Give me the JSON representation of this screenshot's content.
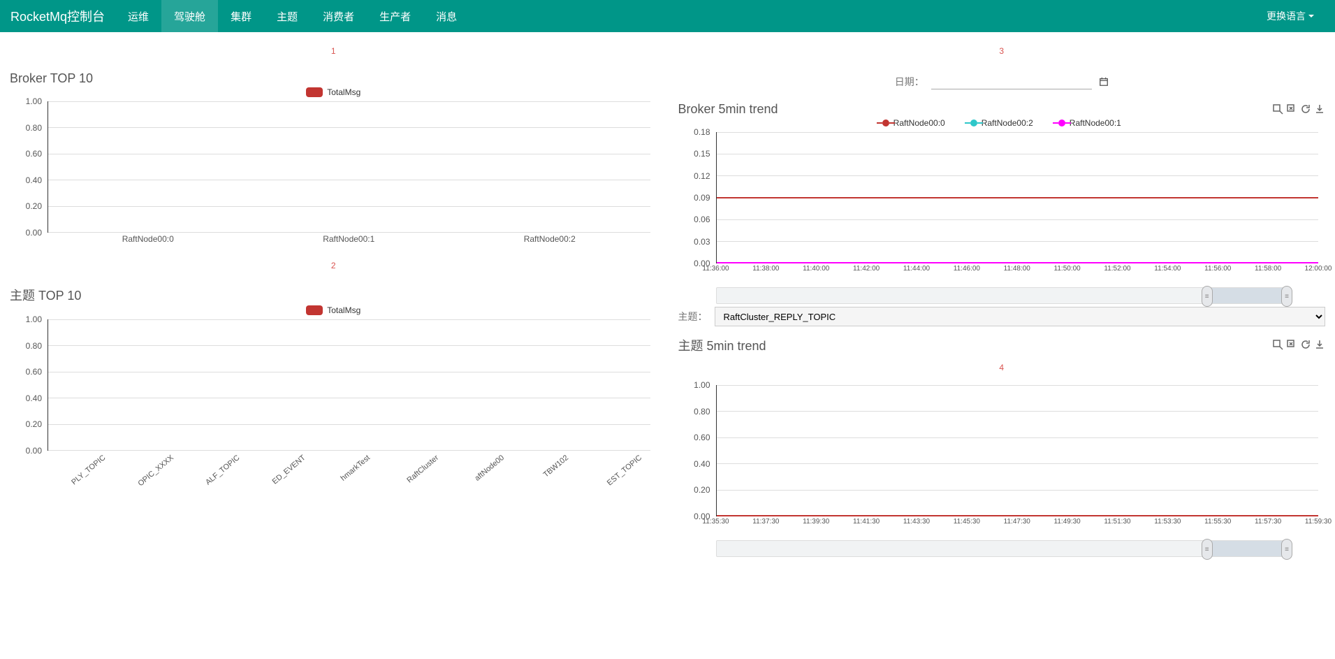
{
  "nav": {
    "brand": "RocketMq控制台",
    "items": [
      "运维",
      "驾驶舱",
      "集群",
      "主题",
      "消费者",
      "生产者",
      "消息"
    ],
    "active_index": 1,
    "lang_label": "更换语言"
  },
  "section_numbers": [
    "1",
    "2",
    "3",
    "4"
  ],
  "date_row": {
    "label": "日期：",
    "value": ""
  },
  "topic_row": {
    "label": "主题：",
    "selected": "RaftCluster_REPLY_TOPIC"
  },
  "chart1": {
    "title": "Broker TOP 10",
    "legend": [
      {
        "label": "TotalMsg",
        "color": "#c23531"
      }
    ]
  },
  "chart2": {
    "title": "主题 TOP 10",
    "legend": [
      {
        "label": "TotalMsg",
        "color": "#c23531"
      }
    ]
  },
  "chart3": {
    "title": "Broker 5min trend",
    "legend": [
      {
        "label": "RaftNode00:0",
        "color": "#c23531"
      },
      {
        "label": "RaftNode00:2",
        "color": "#2ec7c9"
      },
      {
        "label": "RaftNode00:1",
        "color": "#ff00ff"
      }
    ]
  },
  "chart4": {
    "title": "主题 5min trend"
  },
  "chart_data": [
    {
      "id": "chart1",
      "type": "bar",
      "title": "Broker TOP 10",
      "categories": [
        "RaftNode00:0",
        "RaftNode00:1",
        "RaftNode00:2"
      ],
      "series": [
        {
          "name": "TotalMsg",
          "values": [
            0,
            0,
            0
          ]
        }
      ],
      "ylim": [
        0,
        1.0
      ],
      "yticks": [
        0.0,
        0.2,
        0.4,
        0.6,
        0.8,
        1.0
      ]
    },
    {
      "id": "chart2",
      "type": "bar",
      "title": "主题 TOP 10",
      "categories": [
        "PLY_TOPIC",
        "OPIC_XXXX",
        "ALF_TOPIC",
        "ED_EVENT",
        "hmarkTest",
        "RaftCluster",
        "aftNode00",
        "TBW102",
        "EST_TOPIC"
      ],
      "series": [
        {
          "name": "TotalMsg",
          "values": [
            0,
            0,
            0,
            0,
            0,
            0,
            0,
            0,
            0
          ]
        }
      ],
      "ylim": [
        0,
        1.0
      ],
      "yticks": [
        0.0,
        0.2,
        0.4,
        0.6,
        0.8,
        1.0
      ]
    },
    {
      "id": "chart3",
      "type": "line",
      "title": "Broker 5min trend",
      "x": [
        "11:36:00",
        "11:38:00",
        "11:40:00",
        "11:42:00",
        "11:44:00",
        "11:46:00",
        "11:48:00",
        "11:50:00",
        "11:52:00",
        "11:54:00",
        "11:56:00",
        "11:58:00",
        "12:00:00"
      ],
      "series": [
        {
          "name": "RaftNode00:0",
          "value_constant": 0.09
        },
        {
          "name": "RaftNode00:2",
          "value_constant": 0.0
        },
        {
          "name": "RaftNode00:1",
          "value_constant": 0.0
        }
      ],
      "ylim": [
        0,
        0.18
      ],
      "yticks": [
        0.0,
        0.03,
        0.06,
        0.09,
        0.12,
        0.15,
        0.18
      ],
      "datazoom": {
        "start_pct": 86,
        "end_pct": 100
      }
    },
    {
      "id": "chart4",
      "type": "line",
      "title": "主题 5min trend",
      "x": [
        "11:35:30",
        "11:37:30",
        "11:39:30",
        "11:41:30",
        "11:43:30",
        "11:45:30",
        "11:47:30",
        "11:49:30",
        "11:51:30",
        "11:53:30",
        "11:55:30",
        "11:57:30",
        "11:59:30"
      ],
      "series": [
        {
          "name": "RaftCluster_REPLY_TOPIC",
          "value_constant": 0
        }
      ],
      "ylim": [
        0,
        1.0
      ],
      "yticks": [
        0.0,
        0.2,
        0.4,
        0.6,
        0.8,
        1.0
      ],
      "datazoom": {
        "start_pct": 86,
        "end_pct": 100
      }
    }
  ]
}
